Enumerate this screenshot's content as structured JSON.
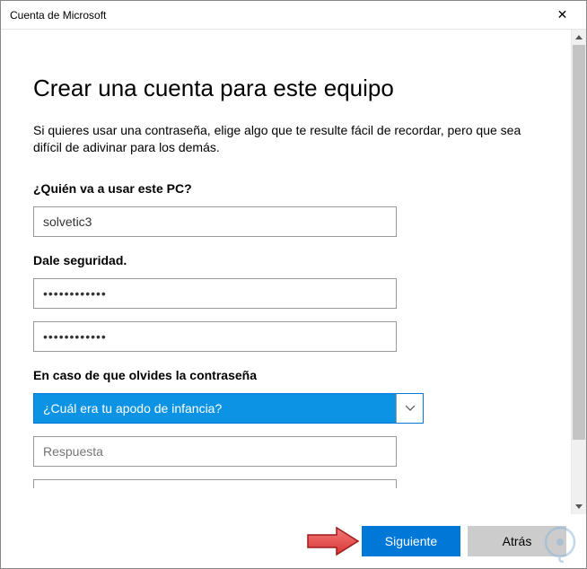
{
  "window": {
    "title": "Cuenta de Microsoft"
  },
  "page": {
    "heading": "Crear una cuenta para este equipo",
    "description": "Si quieres usar una contraseña, elige algo que te resulte fácil de recordar, pero que sea difícil de adivinar para los demás."
  },
  "form": {
    "who_label": "¿Quién va a usar este PC?",
    "who_value": "solvetic3",
    "security_label": "Dale seguridad.",
    "password1_value": "••••••••••••",
    "password2_value": "••••••••••••",
    "forgot_label": "En caso de que olvides la contraseña",
    "question_selected": "¿Cuál era tu apodo de infancia?",
    "answer_placeholder": "Respuesta"
  },
  "buttons": {
    "next": "Siguiente",
    "back": "Atrás"
  }
}
